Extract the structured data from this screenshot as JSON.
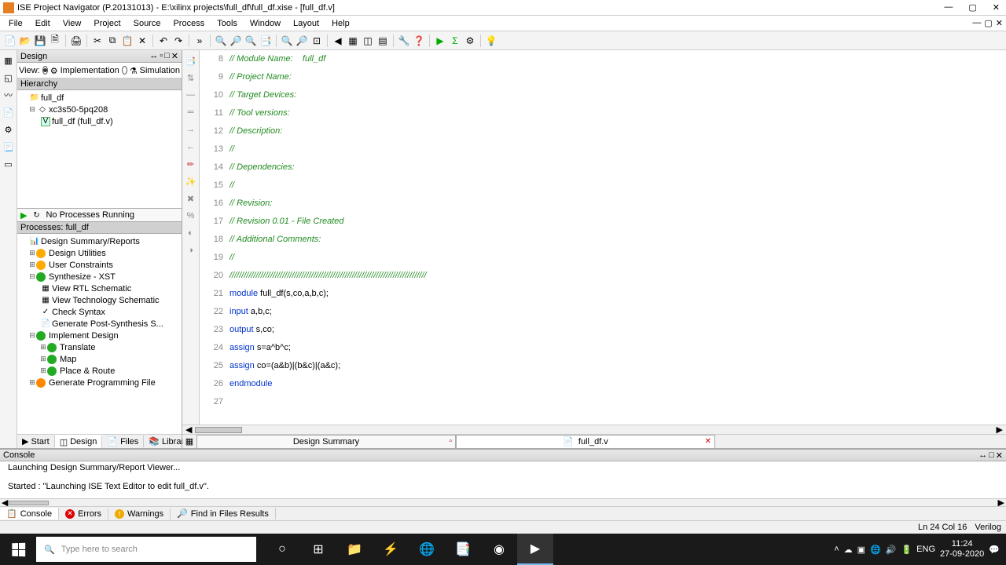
{
  "titlebar": {
    "text": "ISE Project Navigator (P.20131013) - E:\\xilinx projects\\full_df\\full_df.xise - [full_df.v]"
  },
  "menubar": {
    "items": [
      "File",
      "Edit",
      "View",
      "Project",
      "Source",
      "Process",
      "Tools",
      "Window",
      "Layout",
      "Help"
    ]
  },
  "design_panel": {
    "title": "Design",
    "view_label": "View:",
    "impl_label": "Implementation",
    "sim_label": "Simulation",
    "hierarchy_label": "Hierarchy",
    "tree": {
      "project": "full_df",
      "device": "xc3s50-5pq208",
      "module": "full_df (full_df.v)"
    },
    "no_processes": "No Processes Running",
    "processes_label": "Processes: full_df",
    "processes": [
      "Design Summary/Reports",
      "Design Utilities",
      "User Constraints",
      "Synthesize - XST",
      "View RTL Schematic",
      "View Technology Schematic",
      "Check Syntax",
      "Generate Post-Synthesis S...",
      "Implement Design",
      "Translate",
      "Map",
      "Place & Route",
      "Generate Programming File"
    ]
  },
  "bottom_tabs": [
    "Start",
    "Design",
    "Files",
    "Libraries"
  ],
  "editor": {
    "lines": [
      {
        "n": 8,
        "txt": "// Module Name:    full_df ",
        "cls": "tok-comment"
      },
      {
        "n": 9,
        "txt": "// Project Name: ",
        "cls": "tok-comment"
      },
      {
        "n": 10,
        "txt": "// Target Devices: ",
        "cls": "tok-comment"
      },
      {
        "n": 11,
        "txt": "// Tool versions: ",
        "cls": "tok-comment"
      },
      {
        "n": 12,
        "txt": "// Description: ",
        "cls": "tok-comment"
      },
      {
        "n": 13,
        "txt": "//",
        "cls": "tok-comment"
      },
      {
        "n": 14,
        "txt": "// Dependencies: ",
        "cls": "tok-comment"
      },
      {
        "n": 15,
        "txt": "//",
        "cls": "tok-comment"
      },
      {
        "n": 16,
        "txt": "// Revision: ",
        "cls": "tok-comment"
      },
      {
        "n": 17,
        "txt": "// Revision 0.01 - File Created",
        "cls": "tok-comment"
      },
      {
        "n": 18,
        "txt": "// Additional Comments: ",
        "cls": "tok-comment"
      },
      {
        "n": 19,
        "txt": "//",
        "cls": "tok-comment"
      },
      {
        "n": 20,
        "txt": "//////////////////////////////////////////////////////////////////////////////////",
        "cls": "tok-comment"
      }
    ],
    "code_lines": [
      {
        "n": 21,
        "parts": [
          {
            "t": "module",
            "c": "tok-keyword"
          },
          {
            "t": " full_df(s,co,a,b,c);",
            "c": "tok-ident"
          }
        ]
      },
      {
        "n": 22,
        "parts": [
          {
            "t": "input",
            "c": "tok-keyword"
          },
          {
            "t": " a,b,c;",
            "c": "tok-ident"
          }
        ]
      },
      {
        "n": 23,
        "parts": [
          {
            "t": "output",
            "c": "tok-keyword"
          },
          {
            "t": " s,co;",
            "c": "tok-ident"
          }
        ]
      },
      {
        "n": 24,
        "parts": [
          {
            "t": "assign",
            "c": "tok-keyword"
          },
          {
            "t": " s=a^b^c;",
            "c": "tok-ident"
          }
        ]
      },
      {
        "n": 25,
        "parts": [
          {
            "t": "assign",
            "c": "tok-keyword"
          },
          {
            "t": " co=(a&b)|(b&c)|(a&c);",
            "c": "tok-ident"
          }
        ]
      },
      {
        "n": 26,
        "parts": [
          {
            "t": "endmodule",
            "c": "tok-keyword"
          }
        ]
      },
      {
        "n": 27,
        "parts": [
          {
            "t": "",
            "c": "tok-ident"
          }
        ]
      }
    ],
    "tabs": {
      "summary": "Design Summary",
      "file": "full_df.v"
    }
  },
  "console": {
    "title": "Console",
    "lines": [
      "Launching Design Summary/Report Viewer...",
      "",
      "Started : \"Launching ISE Text Editor to edit full_df.v\"."
    ],
    "tabs": [
      "Console",
      "Errors",
      "Warnings",
      "Find in Files Results"
    ]
  },
  "statusbar": {
    "pos": "Ln 24 Col 16",
    "lang": "Verilog"
  },
  "taskbar": {
    "search_placeholder": "Type here to search",
    "lang": "ENG",
    "time": "11:24",
    "date": "27-09-2020"
  }
}
